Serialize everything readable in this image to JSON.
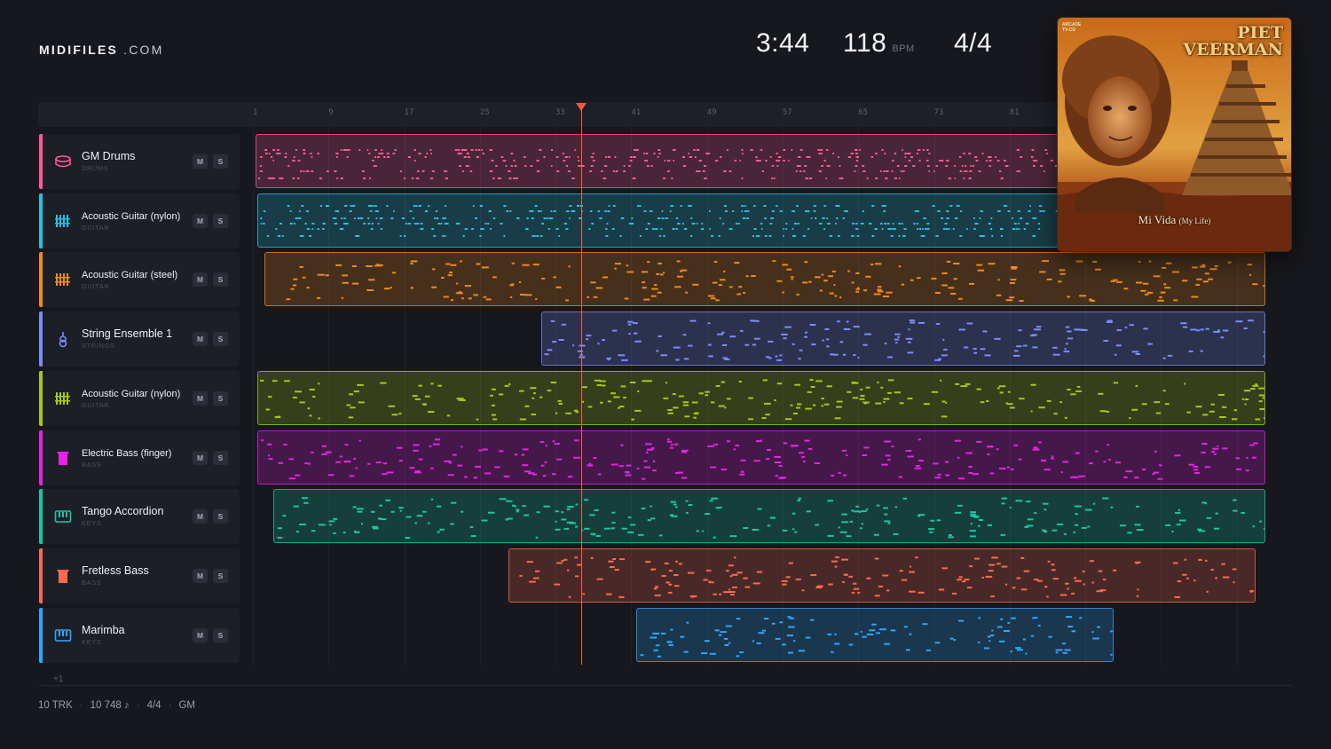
{
  "brand": {
    "name_bold": "MIDIFILES",
    "name_rest": ".COM"
  },
  "transport": {
    "duration": "3:44",
    "tempo": "118",
    "tempo_unit": "BPM",
    "time_signature": "4/4",
    "playhead_bar": 34
  },
  "ruler": {
    "ticks": [
      "1",
      "9",
      "17",
      "25",
      "33",
      "41",
      "49",
      "57",
      "65",
      "73",
      "81"
    ]
  },
  "tracks": [
    {
      "name": "GM Drums",
      "category": "DRUMS",
      "color": "#ff5a95",
      "icon": "drum-icon",
      "mute": "M",
      "solo": "S",
      "clip_start_bar": 1.3,
      "clip_end_bar": 108
    },
    {
      "name": "Acoustic Guitar (nylon)",
      "category": "GUITAR",
      "color": "#25c2e2",
      "icon": "guitar-fret-icon",
      "mute": "M",
      "solo": "S",
      "clip_start_bar": 1.5,
      "clip_end_bar": 108
    },
    {
      "name": "Acoustic Guitar (steel)",
      "category": "GUITAR",
      "color": "#f08a1a",
      "icon": "guitar-fret-icon",
      "mute": "M",
      "solo": "S",
      "clip_start_bar": 2.2,
      "clip_end_bar": 108
    },
    {
      "name": "String Ensemble 1",
      "category": "STRINGS",
      "color": "#7b8cff",
      "icon": "violin-icon",
      "mute": "M",
      "solo": "S",
      "clip_start_bar": 31.5,
      "clip_end_bar": 108
    },
    {
      "name": "Acoustic Guitar (nylon)",
      "category": "GUITAR",
      "color": "#a8c818",
      "icon": "guitar-fret-icon",
      "mute": "M",
      "solo": "S",
      "clip_start_bar": 1.5,
      "clip_end_bar": 108
    },
    {
      "name": "Electric Bass (finger)",
      "category": "BASS",
      "color": "#e822e8",
      "icon": "bass-icon",
      "mute": "M",
      "solo": "S",
      "clip_start_bar": 1.5,
      "clip_end_bar": 108
    },
    {
      "name": "Tango Accordion",
      "category": "KEYS",
      "color": "#17c8a6",
      "icon": "keyboard-icon",
      "mute": "M",
      "solo": "S",
      "clip_start_bar": 3.2,
      "clip_end_bar": 108
    },
    {
      "name": "Fretless Bass",
      "category": "BASS",
      "color": "#ff6a4c",
      "icon": "bass-icon",
      "mute": "M",
      "solo": "S",
      "clip_start_bar": 28,
      "clip_end_bar": 107
    },
    {
      "name": "Marimba",
      "category": "KEYS",
      "color": "#2aa8ff",
      "icon": "keyboard-icon",
      "mute": "M",
      "solo": "S",
      "clip_start_bar": 41.5,
      "clip_end_bar": 92
    }
  ],
  "more_tracks": "+1",
  "status": {
    "tracks": "10 TRK",
    "notes": "10 748 ♪",
    "time_signature": "4/4",
    "standard": "GM"
  },
  "album": {
    "artist_line1": "PIET",
    "artist_line2": "VEERMAN",
    "title": "Mi Vida",
    "subtitle": "(My Life)",
    "label_line1": "ARCADE",
    "label_line2": "TV-CD"
  }
}
